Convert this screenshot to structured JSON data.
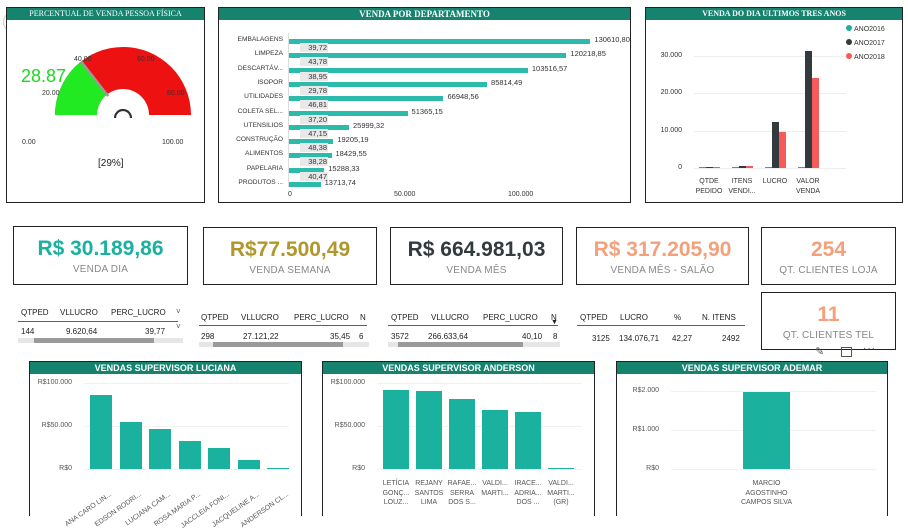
{
  "gauge": {
    "title": "PERCENTUAL DE VENDA PESSOA FÍSICA",
    "value": "28.87",
    "value_num": 28.87,
    "percent_label": "[29%]",
    "ticks": [
      "0.00",
      "20.00",
      "40.00",
      "60.00",
      "80.00",
      "100.00"
    ],
    "colors": {
      "low": "#22ea22",
      "high": "#ee1111",
      "value_text": "#1ed81e"
    }
  },
  "dept": {
    "title": "VENDA POR DEPARTAMENTO",
    "axis": [
      "0",
      "50.000",
      "100.000"
    ],
    "max": 130000,
    "rows": [
      {
        "name": "EMBALAGENS",
        "value": 130610.8,
        "label": "130610,80",
        "pct": "39,72"
      },
      {
        "name": "LIMPEZA",
        "value": 120218.85,
        "label": "120218,85",
        "pct": "43,78"
      },
      {
        "name": "DESCARTÁV...",
        "value": 103516.57,
        "label": "103516,57",
        "pct": "38,95"
      },
      {
        "name": "ISOPOR",
        "value": 85814.49,
        "label": "85814,49",
        "pct": "29,78"
      },
      {
        "name": "UTILIDADES",
        "value": 66948.56,
        "label": "66948,56",
        "pct": "46,81"
      },
      {
        "name": "COLETA SEL...",
        "value": 51365.15,
        "label": "51365,15",
        "pct": "37,20"
      },
      {
        "name": "UTENSILIOS",
        "value": 25999.32,
        "label": "25999,32",
        "pct": "47,15"
      },
      {
        "name": "CONSTRUÇÃO",
        "value": 19205.19,
        "label": "19205,19",
        "pct": "48,38"
      },
      {
        "name": "ALIMENTOS",
        "value": 18429.55,
        "label": "18429,55",
        "pct": "38,28"
      },
      {
        "name": "PAPELARIA",
        "value": 15288.33,
        "label": "15288,33",
        "pct": "40,47"
      },
      {
        "name": "PRODUTOS ...",
        "value": 13713.74,
        "label": "13713,74",
        "pct": ""
      }
    ]
  },
  "three_years": {
    "title": "VENDA DO DIA ULTIMOS TRES ANOS",
    "yticks": [
      "30.000",
      "20.000",
      "10.000",
      "0"
    ],
    "ymax": 36000,
    "legend": [
      "ANO2016",
      "ANO2017",
      "ANO2018"
    ],
    "colors": [
      "#1bb19f",
      "#333a3e",
      "#f75a5a"
    ],
    "categories": [
      [
        "QTDE",
        "PEDIDO"
      ],
      [
        "ITENS",
        "VENDI..."
      ],
      [
        "LUCRO"
      ],
      [
        "VALOR",
        "VENDA"
      ]
    ],
    "values": [
      [
        150,
        400,
        280
      ],
      [
        180,
        600,
        420
      ],
      [
        0,
        12200,
        9600
      ],
      [
        0,
        31300,
        24000
      ]
    ]
  },
  "kpis": [
    {
      "value": "R$ 30.189,86",
      "label": "VENDA DIA",
      "color": "#1bb19f"
    },
    {
      "value": "R$77.500,49",
      "label": "VENDA SEMANA",
      "color": "#b0972b"
    },
    {
      "value": "R$ 664.981,03",
      "label": "VENDA MÊS",
      "color": "#333a3e"
    },
    {
      "value": "R$ 317.205,90",
      "label": "VENDA MÊS - SALÃO",
      "color": "#f4a07a"
    },
    {
      "value": "254",
      "label": "QT. CLIENTES LOJA",
      "color": "#f4a07a"
    },
    {
      "value": "11",
      "label": "QT. CLIENTES TEL",
      "color": "#f4a07a"
    }
  ],
  "tables": [
    {
      "h": [
        "QTPED",
        "VLLUCRO",
        "PERC_LUCRO"
      ],
      "r": [
        "144",
        "9.620,64",
        "39,77"
      ]
    },
    {
      "h": [
        "QTPED",
        "VLLUCRO",
        "PERC_LUCRO",
        "N"
      ],
      "r": [
        "298",
        "27.121,22",
        "35,45",
        "6"
      ]
    },
    {
      "h": [
        "QTPED",
        "VLLUCRO",
        "PERC_LUCRO",
        "N"
      ],
      "r": [
        "3572",
        "266.633,64",
        "40,10",
        "8"
      ]
    },
    {
      "h": [
        "QTPED",
        "LUCRO",
        "%",
        "N. ITENS"
      ],
      "r": [
        "3125",
        "134.076,71",
        "42,27",
        "2492"
      ]
    }
  ],
  "sup": [
    {
      "title": "VENDAS SUPERVISOR LUCIANA",
      "yticks": [
        "R$100.000",
        "R$50.000",
        "R$0"
      ],
      "ymax": 100000,
      "names": [
        "ANA CARO LIN...",
        "EDSON RODRI...",
        "LUCIANA CAM...",
        "ROSA MARIA P...",
        "JACCLEIA FONI...",
        "JACQUELINE A...",
        "ANDERSON CL..."
      ],
      "values": [
        86000,
        55000,
        46000,
        32000,
        24000,
        10000,
        1500
      ]
    },
    {
      "title": "VENDAS SUPERVISOR ANDERSON",
      "yticks": [
        "R$100.000",
        "R$50.000",
        "R$0"
      ],
      "ymax": 100000,
      "names": [
        "LETÍCIA GONÇ... LOUZ...",
        "REJANY SANTOS LIMA",
        "RAFAE... SERRA DOS S...",
        "VALDI... MARTI...",
        "IRACE... ADRIA... DOS ...",
        "VALDI... MARTI... (GR)"
      ],
      "values": [
        92000,
        91000,
        81000,
        69000,
        66000,
        1000
      ]
    },
    {
      "title": "VENDAS SUPERVISOR ADEMAR",
      "yticks": [
        "R$2.000",
        "R$1.000",
        "R$0"
      ],
      "ymax": 2200,
      "names": [
        "MARCIO AGOSTINHO CAMPOS SILVA"
      ],
      "values": [
        1960
      ]
    }
  ]
}
